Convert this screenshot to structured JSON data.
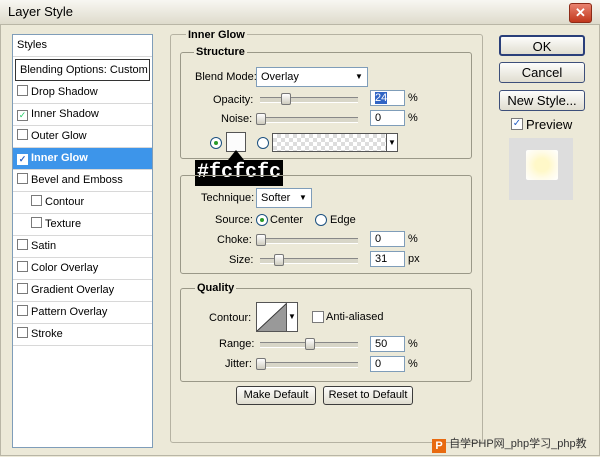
{
  "window": {
    "title": "Layer Style",
    "close": "✕"
  },
  "styles_list": [
    {
      "label": "Styles",
      "type": "header"
    },
    {
      "label": "Blending Options: Custom",
      "type": "header"
    },
    {
      "label": "Drop Shadow",
      "checked": false
    },
    {
      "label": "Inner Shadow",
      "checked": true
    },
    {
      "label": "Outer Glow",
      "checked": false
    },
    {
      "label": "Inner Glow",
      "checked": true,
      "selected": true
    },
    {
      "label": "Bevel and Emboss",
      "checked": false
    },
    {
      "label": "Contour",
      "checked": false,
      "indent": true
    },
    {
      "label": "Texture",
      "checked": false,
      "indent": true
    },
    {
      "label": "Satin",
      "checked": false
    },
    {
      "label": "Color Overlay",
      "checked": false
    },
    {
      "label": "Gradient Overlay",
      "checked": false
    },
    {
      "label": "Pattern Overlay",
      "checked": false
    },
    {
      "label": "Stroke",
      "checked": false
    }
  ],
  "inner_glow": {
    "title": "Inner Glow",
    "structure": {
      "title": "Structure",
      "blend_mode_label": "Blend Mode:",
      "blend_mode_value": "Overlay",
      "opacity_label": "Opacity:",
      "opacity_value": "24",
      "noise_label": "Noise:",
      "noise_value": "0",
      "percent": "%"
    },
    "color_callout": "#fcfcfc",
    "elements": {
      "technique_label": "Technique:",
      "technique_value": "Softer",
      "source_label": "Source:",
      "source_center": "Center",
      "source_edge": "Edge",
      "choke_label": "Choke:",
      "choke_value": "0",
      "size_label": "Size:",
      "size_value": "31",
      "px": "px",
      "percent": "%"
    },
    "quality": {
      "title": "Quality",
      "contour_label": "Contour:",
      "anti_aliased": "Anti-aliased",
      "range_label": "Range:",
      "range_value": "50",
      "jitter_label": "Jitter:",
      "jitter_value": "0",
      "percent": "%"
    },
    "make_default": "Make Default",
    "reset_default": "Reset to Default"
  },
  "side_buttons": {
    "ok": "OK",
    "cancel": "Cancel",
    "new_style": "New Style...",
    "preview": "Preview"
  },
  "watermark": "自学PHP网_php学习_php教",
  "colors": {
    "selection": "#3d95ea",
    "glow": "#fcfcfc",
    "dialog_bg": "#ece9d8"
  }
}
